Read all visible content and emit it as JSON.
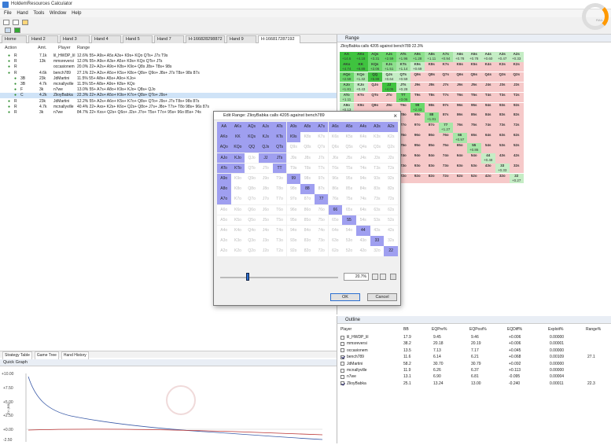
{
  "window": {
    "title": "HoldemResources Calculator"
  },
  "menu": [
    "File",
    "Hand",
    "Tools",
    "Window",
    "Help"
  ],
  "tabs": [
    "Home",
    "Hand 2",
    "Hand 3",
    "Hand 4",
    "Hand 5",
    "Hand 7",
    "H-166828298872",
    "Hand 9",
    "H-166817287192"
  ],
  "hands": {
    "headers": [
      "Action",
      "Amt.",
      "Player",
      "Range"
    ],
    "rows": [
      {
        "action": "R",
        "amt": "7.1k",
        "player": "lil_HWDP_lil",
        "range": "12.6% 55+ A9s+ A5s A3s+ K9s+ KQo QTs+ J7s T9s"
      },
      {
        "action": "R",
        "amt": "13k",
        "player": "mmsreversi",
        "range": "12.0% 55+ A9s+ A3s+ A5s+ K9s+ KQo QTs+ JTs"
      },
      {
        "action": "R",
        "amt": "",
        "player": "occasionem",
        "range": "20.0% 22+ A2s+ A9o+ K8s+ K9o+ Q8s J8s+ T8s+ 98s"
      },
      {
        "action": "R",
        "amt": "4.6k",
        "player": "bench789",
        "range": "27.1% 22+ A2s+ A5o+ K5s+ K8o+ Q8s+ Q9o+ J8s+ J7s T8s+ 98s 87s"
      },
      {
        "action": "3B",
        "amt": "23k",
        "player": "JdMartini",
        "range": "11.5% 55+ A8s+ A5s+ A9o+ KJo+"
      },
      {
        "action": "3B",
        "amt": "4.7k",
        "player": "mcnallyville",
        "range": "11.5% 55+ A8s+ A9o+ K8s+ KQo"
      },
      {
        "action": "F",
        "amt": "3k",
        "player": "n7we",
        "range": "13.0% 55+ A7s+ A8o+ K9s+ KJo+ Q8s+ QJo"
      },
      {
        "action": "C",
        "amt": "4.2k",
        "player": "ZlioyBabka",
        "range": "22.3% 22+ A2s+ A5o+ K9s+ K7o+ Q8s+ QTo+ J9s+"
      },
      {
        "action": "R",
        "amt": "23k",
        "player": "JdMartini",
        "range": "12.2% 55+ A2s+ A6o+ K5s+ K7o+ Q8s+ QTo+ J9s+ J7s T8s+ 98s 87s"
      },
      {
        "action": "R",
        "amt": "4.7k",
        "player": "mcnallyville",
        "range": "40.4% 22+ Axs+ K2s+ K6o+ Q2s+ Q8o+ J7s+ J8o+ T7s+ T8o 98s+ 96s 87s"
      },
      {
        "action": "R",
        "amt": "3k",
        "player": "n7we",
        "range": "84.7% 22+ Kxs+ Q2s+ Q6o+ J2s+ J7o+ T5s+ T7o+ 95s+ 96o 85s+ 74s"
      }
    ]
  },
  "bottom_tabs": [
    "Strategy Table",
    "Game Tree",
    "Hand History"
  ],
  "quick_graph": {
    "title": "Quick Graph",
    "yaxis_label": "EV (BB)",
    "yticks": [
      "+10.00",
      "+7.50",
      "+5.00",
      "+2.50",
      "+0.00",
      "-2.50"
    ]
  },
  "range_panel": {
    "title": "Range",
    "subtitle": "ZlioyBabka calls 4205 against bench789 22.3%",
    "cells": [
      {
        "label": "AA",
        "v": "+14.6",
        "c": "#3fc33f"
      },
      {
        "label": "AKs",
        "v": "+4.18",
        "c": "#3fc33f"
      },
      {
        "label": "AQs",
        "v": "+3.31",
        "c": "#6ad86a"
      },
      {
        "label": "AJs",
        "v": "+2.59",
        "c": "#6ad86a"
      },
      {
        "label": "ATs",
        "v": "+1.96",
        "c": "#8de08d"
      },
      {
        "label": "A9s",
        "v": "+1.28",
        "c": "#8de08d"
      },
      {
        "label": "A8s",
        "v": "+1.11",
        "c": "#a7e6a7"
      },
      {
        "label": "A7s",
        "v": "+0.94",
        "c": "#a7e6a7"
      },
      {
        "label": "A6s",
        "v": "+0.78",
        "c": "#c5edc5"
      },
      {
        "label": "A5s",
        "v": "+0.78",
        "c": "#c5edc5"
      },
      {
        "label": "A4s",
        "v": "+0.60",
        "c": "#c5edc5"
      },
      {
        "label": "A3s",
        "v": "+0.47",
        "c": "#c5edc5"
      },
      {
        "label": "A2s",
        "v": "+0.33",
        "c": "#c5edc5"
      },
      {
        "label": "AKo",
        "v": "+4.74",
        "c": "#3fc33f"
      },
      {
        "label": "KK",
        "v": "+8.89",
        "c": "#3fc33f"
      },
      {
        "label": "KQs",
        "v": "+2.06",
        "c": "#6ad86a"
      },
      {
        "label": "KJs",
        "v": "+1.51",
        "c": "#8de08d"
      },
      {
        "label": "KTs",
        "v": "+1.14",
        "c": "#a7e6a7"
      },
      {
        "label": "K9s",
        "v": "+0.69",
        "c": "#c5edc5"
      },
      {
        "label": "K8s",
        "v": "",
        "c": "#f6c9c9"
      },
      {
        "label": "K7s",
        "v": "",
        "c": "#f6c9c9"
      },
      {
        "label": "K6s",
        "v": "",
        "c": "#f6c9c9"
      },
      {
        "label": "K5s",
        "v": "",
        "c": "#f6c9c9"
      },
      {
        "label": "K4s",
        "v": "",
        "c": "#f6c9c9"
      },
      {
        "label": "K3s",
        "v": "",
        "c": "#f6c9c9"
      },
      {
        "label": "K2s",
        "v": "",
        "c": "#f6c9c9"
      },
      {
        "label": "AQo",
        "v": "+2.59",
        "c": "#6ad86a"
      },
      {
        "label": "KQo",
        "v": "+1.32",
        "c": "#a7e6a7"
      },
      {
        "label": "QQ",
        "v": "+5.89",
        "c": "#3fc33f"
      },
      {
        "label": "QJs",
        "v": "+0.64",
        "c": "#c5edc5"
      },
      {
        "label": "QTs",
        "v": "+0.59",
        "c": "#c5edc5"
      },
      {
        "label": "Q9s",
        "v": "",
        "c": "#f6c9c9"
      },
      {
        "label": "Q8s",
        "v": "",
        "c": "#f6c9c9"
      },
      {
        "label": "Q7s",
        "v": "",
        "c": "#f6c9c9"
      },
      {
        "label": "Q6s",
        "v": "",
        "c": "#f6c9c9"
      },
      {
        "label": "Q5s",
        "v": "",
        "c": "#f6c9c9"
      },
      {
        "label": "Q4s",
        "v": "",
        "c": "#f6c9c9"
      },
      {
        "label": "Q3s",
        "v": "",
        "c": "#f6c9c9"
      },
      {
        "label": "Q2s",
        "v": "",
        "c": "#f6c9c9"
      },
      {
        "label": "AJo",
        "v": "+1.81",
        "c": "#8de08d"
      },
      {
        "label": "KJo",
        "v": "+0.43",
        "c": "#c5edc5"
      },
      {
        "label": "QJo",
        "v": "",
        "c": "#f6c9c9"
      },
      {
        "label": "JJ",
        "v": "+4.05",
        "c": "#3fc33f"
      },
      {
        "label": "JTs",
        "v": "+0.28",
        "c": "#c5edc5"
      },
      {
        "label": "J9s",
        "v": "",
        "c": "#f6c9c9"
      },
      {
        "label": "J8s",
        "v": "",
        "c": "#f6c9c9"
      },
      {
        "label": "J7s",
        "v": "",
        "c": "#f6c9c9"
      },
      {
        "label": "J6s",
        "v": "",
        "c": "#f6c9c9"
      },
      {
        "label": "J5s",
        "v": "",
        "c": "#f6c9c9"
      },
      {
        "label": "J4s",
        "v": "",
        "c": "#f6c9c9"
      },
      {
        "label": "J3s",
        "v": "",
        "c": "#f6c9c9"
      },
      {
        "label": "J2s",
        "v": "",
        "c": "#f6c9c9"
      },
      {
        "label": "ATo",
        "v": "+1.11",
        "c": "#a7e6a7"
      },
      {
        "label": "KTo",
        "v": "",
        "c": "#f6c9c9"
      },
      {
        "label": "QTo",
        "v": "",
        "c": "#f6c9c9"
      },
      {
        "label": "JTo",
        "v": "",
        "c": "#f6c9c9"
      },
      {
        "label": "TT",
        "v": "+3.06",
        "c": "#6ad86a"
      },
      {
        "label": "T9s",
        "v": "",
        "c": "#f6c9c9"
      },
      {
        "label": "T8s",
        "v": "",
        "c": "#f6c9c9"
      },
      {
        "label": "T7s",
        "v": "",
        "c": "#f6c9c9"
      },
      {
        "label": "T6s",
        "v": "",
        "c": "#f6c9c9"
      },
      {
        "label": "T5s",
        "v": "",
        "c": "#f6c9c9"
      },
      {
        "label": "T4s",
        "v": "",
        "c": "#f6c9c9"
      },
      {
        "label": "T3s",
        "v": "",
        "c": "#f6c9c9"
      },
      {
        "label": "T2s",
        "v": "",
        "c": "#f6c9c9"
      },
      {
        "label": "A9o",
        "v": "+0.13",
        "c": "#c5edc5"
      },
      {
        "label": "K9o",
        "v": "",
        "c": "#f6c9c9"
      },
      {
        "label": "Q9o",
        "v": "",
        "c": "#f6c9c9"
      },
      {
        "label": "J9o",
        "v": "",
        "c": "#f6c9c9"
      },
      {
        "label": "T9o",
        "v": "",
        "c": "#f6c9c9"
      },
      {
        "label": "99",
        "v": "+2.43",
        "c": "#6ad86a"
      },
      {
        "label": "98s",
        "v": "",
        "c": "#f6c9c9"
      },
      {
        "label": "97s",
        "v": "",
        "c": "#f6c9c9"
      },
      {
        "label": "96s",
        "v": "",
        "c": "#f6c9c9"
      },
      {
        "label": "95s",
        "v": "",
        "c": "#f6c9c9"
      },
      {
        "label": "94s",
        "v": "",
        "c": "#f6c9c9"
      },
      {
        "label": "93s",
        "v": "",
        "c": "#f6c9c9"
      },
      {
        "label": "92s",
        "v": "",
        "c": "#f6c9c9"
      },
      {
        "label": "A8o",
        "v": "",
        "c": "#f6c9c9"
      },
      {
        "label": "K8o",
        "v": "",
        "c": "#f6c9c9"
      },
      {
        "label": "Q8o",
        "v": "",
        "c": "#f6c9c9"
      },
      {
        "label": "J8o",
        "v": "",
        "c": "#f6c9c9"
      },
      {
        "label": "T8o",
        "v": "",
        "c": "#f6c9c9"
      },
      {
        "label": "98o",
        "v": "",
        "c": "#f6c9c9"
      },
      {
        "label": "88",
        "v": "+1.81",
        "c": "#8de08d"
      },
      {
        "label": "87s",
        "v": "",
        "c": "#f6c9c9"
      },
      {
        "label": "86s",
        "v": "",
        "c": "#f6c9c9"
      },
      {
        "label": "85s",
        "v": "",
        "c": "#f6c9c9"
      },
      {
        "label": "84s",
        "v": "",
        "c": "#f6c9c9"
      },
      {
        "label": "83s",
        "v": "",
        "c": "#f6c9c9"
      },
      {
        "label": "82s",
        "v": "",
        "c": "#f6c9c9"
      },
      {
        "label": "A7o",
        "v": "",
        "c": "#f6c9c9"
      },
      {
        "label": "K7o",
        "v": "",
        "c": "#f6c9c9"
      },
      {
        "label": "Q7o",
        "v": "",
        "c": "#f6c9c9"
      },
      {
        "label": "J7o",
        "v": "",
        "c": "#f6c9c9"
      },
      {
        "label": "T7o",
        "v": "",
        "c": "#f6c9c9"
      },
      {
        "label": "97o",
        "v": "",
        "c": "#f6c9c9"
      },
      {
        "label": "87o",
        "v": "",
        "c": "#f6c9c9"
      },
      {
        "label": "77",
        "v": "+1.27",
        "c": "#a7e6a7"
      },
      {
        "label": "76s",
        "v": "",
        "c": "#f6c9c9"
      },
      {
        "label": "75s",
        "v": "",
        "c": "#f6c9c9"
      },
      {
        "label": "74s",
        "v": "",
        "c": "#f6c9c9"
      },
      {
        "label": "73s",
        "v": "",
        "c": "#f6c9c9"
      },
      {
        "label": "72s",
        "v": "",
        "c": "#f6c9c9"
      },
      {
        "label": "A6o",
        "v": "",
        "c": "#f6c9c9"
      },
      {
        "label": "K6o",
        "v": "",
        "c": "#f6c9c9"
      },
      {
        "label": "Q6o",
        "v": "",
        "c": "#f6c9c9"
      },
      {
        "label": "J6o",
        "v": "",
        "c": "#f6c9c9"
      },
      {
        "label": "T6o",
        "v": "",
        "c": "#f6c9c9"
      },
      {
        "label": "96o",
        "v": "",
        "c": "#f6c9c9"
      },
      {
        "label": "86o",
        "v": "",
        "c": "#f6c9c9"
      },
      {
        "label": "76o",
        "v": "",
        "c": "#f6c9c9"
      },
      {
        "label": "66",
        "v": "+0.97",
        "c": "#a7e6a7"
      },
      {
        "label": "65s",
        "v": "",
        "c": "#f6c9c9"
      },
      {
        "label": "64s",
        "v": "",
        "c": "#f6c9c9"
      },
      {
        "label": "63s",
        "v": "",
        "c": "#f6c9c9"
      },
      {
        "label": "62s",
        "v": "",
        "c": "#f6c9c9"
      },
      {
        "label": "A5o",
        "v": "",
        "c": "#f6c9c9"
      },
      {
        "label": "K5o",
        "v": "",
        "c": "#f6c9c9"
      },
      {
        "label": "Q5o",
        "v": "",
        "c": "#f6c9c9"
      },
      {
        "label": "J5o",
        "v": "",
        "c": "#f6c9c9"
      },
      {
        "label": "T5o",
        "v": "",
        "c": "#f6c9c9"
      },
      {
        "label": "95o",
        "v": "",
        "c": "#f6c9c9"
      },
      {
        "label": "85o",
        "v": "",
        "c": "#f6c9c9"
      },
      {
        "label": "75o",
        "v": "",
        "c": "#f6c9c9"
      },
      {
        "label": "65o",
        "v": "",
        "c": "#f6c9c9"
      },
      {
        "label": "55",
        "v": "+0.86",
        "c": "#a7e6a7"
      },
      {
        "label": "54s",
        "v": "",
        "c": "#f6c9c9"
      },
      {
        "label": "53s",
        "v": "",
        "c": "#f6c9c9"
      },
      {
        "label": "52s",
        "v": "",
        "c": "#f6c9c9"
      },
      {
        "label": "A4o",
        "v": "",
        "c": "#f6c9c9"
      },
      {
        "label": "K4o",
        "v": "",
        "c": "#f6c9c9"
      },
      {
        "label": "Q4o",
        "v": "",
        "c": "#f6c9c9"
      },
      {
        "label": "J4o",
        "v": "",
        "c": "#f6c9c9"
      },
      {
        "label": "T4o",
        "v": "",
        "c": "#f6c9c9"
      },
      {
        "label": "94o",
        "v": "",
        "c": "#f6c9c9"
      },
      {
        "label": "84o",
        "v": "",
        "c": "#f6c9c9"
      },
      {
        "label": "74o",
        "v": "",
        "c": "#f6c9c9"
      },
      {
        "label": "64o",
        "v": "",
        "c": "#f6c9c9"
      },
      {
        "label": "54o",
        "v": "",
        "c": "#f6c9c9"
      },
      {
        "label": "44",
        "v": "+0.48",
        "c": "#c5edc5"
      },
      {
        "label": "43s",
        "v": "",
        "c": "#f6c9c9"
      },
      {
        "label": "42s",
        "v": "",
        "c": "#f6c9c9"
      },
      {
        "label": "A3o",
        "v": "",
        "c": "#f6c9c9"
      },
      {
        "label": "K3o",
        "v": "",
        "c": "#f6c9c9"
      },
      {
        "label": "Q3o",
        "v": "",
        "c": "#f6c9c9"
      },
      {
        "label": "J3o",
        "v": "",
        "c": "#f6c9c9"
      },
      {
        "label": "T3o",
        "v": "",
        "c": "#f6c9c9"
      },
      {
        "label": "93o",
        "v": "",
        "c": "#f6c9c9"
      },
      {
        "label": "83o",
        "v": "",
        "c": "#f6c9c9"
      },
      {
        "label": "73o",
        "v": "",
        "c": "#f6c9c9"
      },
      {
        "label": "63o",
        "v": "",
        "c": "#f6c9c9"
      },
      {
        "label": "53o",
        "v": "",
        "c": "#f6c9c9"
      },
      {
        "label": "43o",
        "v": "",
        "c": "#f6c9c9"
      },
      {
        "label": "33",
        "v": "+0.33",
        "c": "#c5edc5"
      },
      {
        "label": "32s",
        "v": "",
        "c": "#f6c9c9"
      },
      {
        "label": "A2o",
        "v": "",
        "c": "#f6c9c9"
      },
      {
        "label": "K2o",
        "v": "",
        "c": "#f6c9c9"
      },
      {
        "label": "Q2o",
        "v": "",
        "c": "#f6c9c9"
      },
      {
        "label": "J2o",
        "v": "",
        "c": "#f6c9c9"
      },
      {
        "label": "T2o",
        "v": "",
        "c": "#f6c9c9"
      },
      {
        "label": "92o",
        "v": "",
        "c": "#f6c9c9"
      },
      {
        "label": "82o",
        "v": "",
        "c": "#f6c9c9"
      },
      {
        "label": "72o",
        "v": "",
        "c": "#f6c9c9"
      },
      {
        "label": "62o",
        "v": "",
        "c": "#f6c9c9"
      },
      {
        "label": "52o",
        "v": "",
        "c": "#f6c9c9"
      },
      {
        "label": "42o",
        "v": "",
        "c": "#f6c9c9"
      },
      {
        "label": "32o",
        "v": "",
        "c": "#f6c9c9"
      },
      {
        "label": "22",
        "v": "+0.27",
        "c": "#c5edc5"
      }
    ]
  },
  "outline": {
    "title": "Outline",
    "headers": [
      "Player",
      "BB",
      "EQPre%",
      "EQPost%",
      "EQDiff%",
      "Exploit%",
      "Range%"
    ],
    "rows": [
      {
        "checked": false,
        "player": "lil_HWDP_lil",
        "bb": "17.9",
        "eqpre": "9.45",
        "eqpost": "9.46",
        "eqdiff": "+0.006",
        "exploit": "0.00000",
        "range": ""
      },
      {
        "checked": false,
        "player": "mmsreversi",
        "bb": "38.2",
        "eqpre": "20.18",
        "eqpost": "20.19",
        "eqdiff": "+0.006",
        "exploit": "0.00001",
        "range": ""
      },
      {
        "checked": false,
        "player": "occasionem",
        "bb": "13.5",
        "eqpre": "7.13",
        "eqpost": "7.17",
        "eqdiff": "+0.045",
        "exploit": "0.00000",
        "range": ""
      },
      {
        "checked": true,
        "player": "bench789",
        "bb": "11.6",
        "eqpre": "6.14",
        "eqpost": "6.21",
        "eqdiff": "+0.068",
        "exploit": "0.00109",
        "range": "27.1"
      },
      {
        "checked": false,
        "player": "JdMartini",
        "bb": "58.2",
        "eqpre": "30.70",
        "eqpost": "30.79",
        "eqdiff": "+0.092",
        "exploit": "0.00000",
        "range": ""
      },
      {
        "checked": false,
        "player": "mcnallyville",
        "bb": "11.9",
        "eqpre": "6.26",
        "eqpost": "6.37",
        "eqdiff": "+0.113",
        "exploit": "0.00000",
        "range": ""
      },
      {
        "checked": false,
        "player": "n7we",
        "bb": "13.1",
        "eqpre": "6.90",
        "eqpost": "6.81",
        "eqdiff": "-0.095",
        "exploit": "0.00004",
        "range": ""
      },
      {
        "checked": true,
        "player": "ZlioyBabka",
        "bb": "25.1",
        "eqpre": "13.24",
        "eqpost": "13.00",
        "eqdiff": "-0.240",
        "exploit": "0.00011",
        "range": "22.3"
      }
    ]
  },
  "dialog": {
    "title": "Edit Range: ZlioyBabka calls 4205 against bench789",
    "percent": "20.7%",
    "slider_fraction": 0.22,
    "ok_label": "OK",
    "cancel_label": "Cancel",
    "selected": [
      "AA",
      "AKs",
      "AQs",
      "AJs",
      "ATs",
      "A9s",
      "A8s",
      "A7s",
      "A6s",
      "A5s",
      "A4s",
      "A3s",
      "A2s",
      "AKo",
      "KK",
      "KQs",
      "KJs",
      "KTs",
      "K9s",
      "AQo",
      "KQo",
      "QQ",
      "QJs",
      "QTs",
      "AJo",
      "KJo",
      "JJ",
      "ATo",
      "KTo",
      "JTs",
      "TT",
      "A9o",
      "99",
      "A8o",
      "88",
      "A7o",
      "77",
      "66",
      "55",
      "44",
      "33",
      "22"
    ]
  },
  "logo_text": "RAIL"
}
